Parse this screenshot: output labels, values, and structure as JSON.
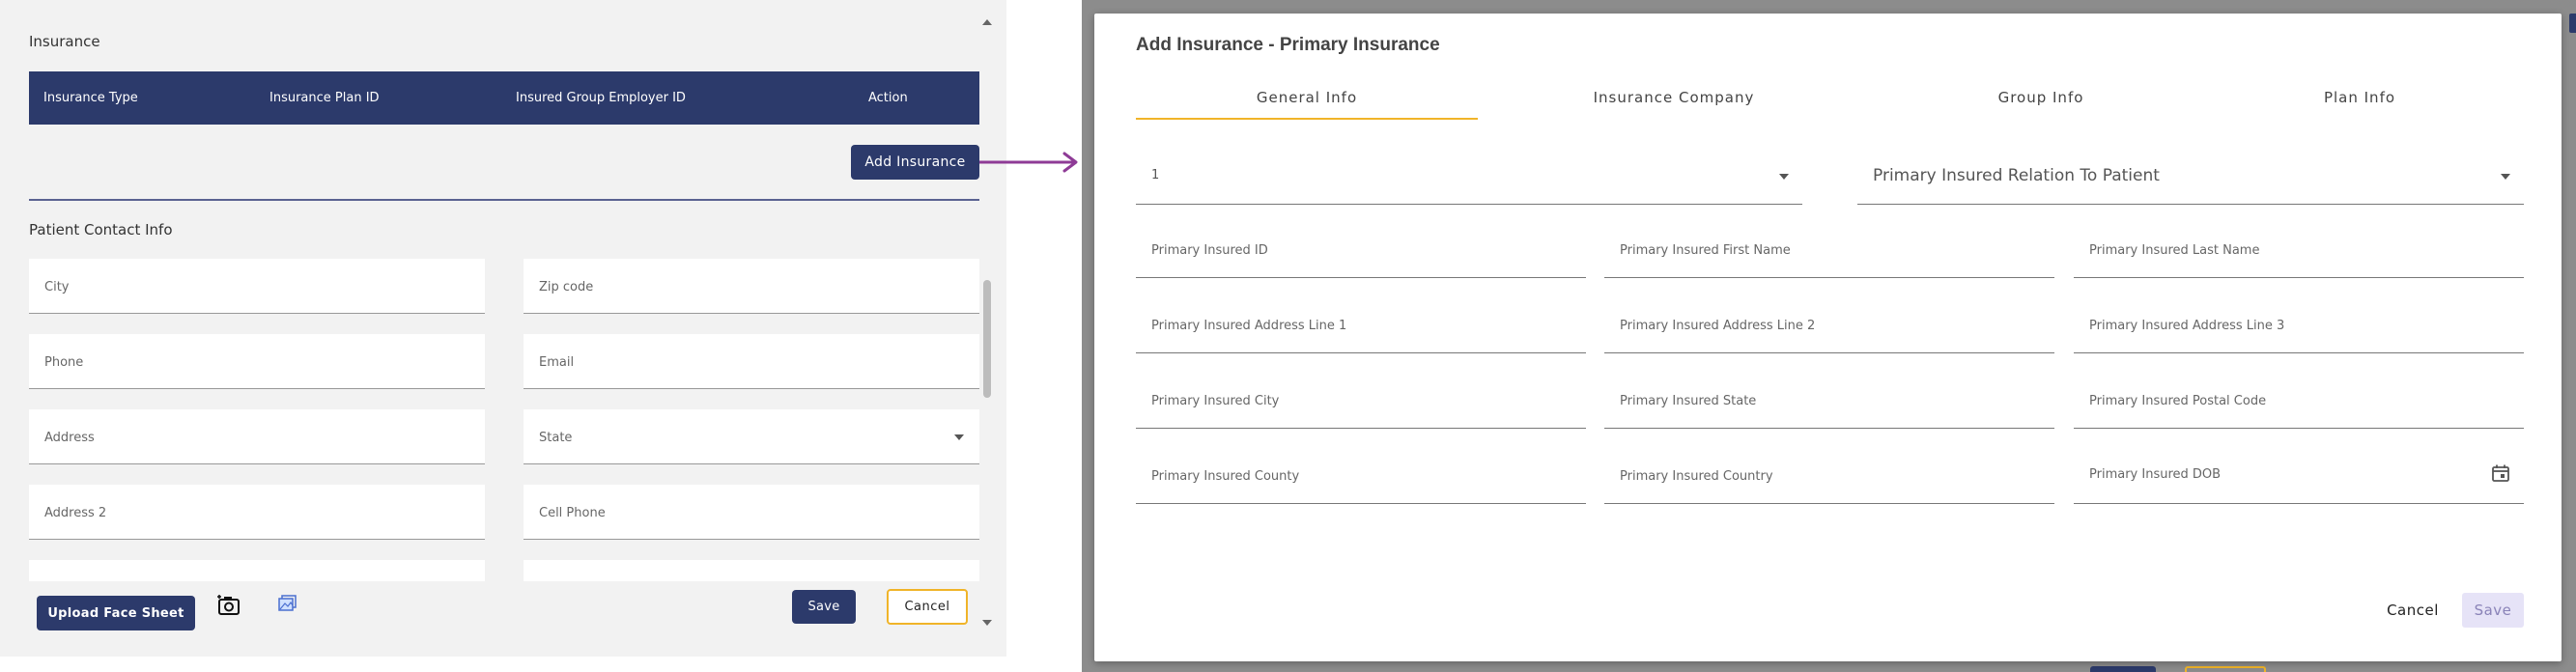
{
  "left": {
    "insurance_heading": "Insurance",
    "table_headers": [
      "Insurance Type",
      "Insurance Plan ID",
      "Insured Group Employer ID",
      "Action"
    ],
    "add_insurance_label": "Add Insurance",
    "contact_heading": "Patient Contact Info",
    "fields": {
      "city": "City",
      "zip": "Zip code",
      "phone": "Phone",
      "email": "Email",
      "address": "Address",
      "state": "State",
      "address2": "Address 2",
      "cell_phone": "Cell Phone"
    },
    "footer": {
      "upload_label": "Upload Face Sheet",
      "save_label": "Save",
      "cancel_label": "Cancel"
    }
  },
  "dialog": {
    "title": "Add Insurance - Primary Insurance",
    "tabs": [
      "General Info",
      "Insurance Company",
      "Group Info",
      "Plan Info"
    ],
    "active_tab": "General Info",
    "select_value": "1",
    "relation_placeholder": "Primary Insured Relation To Patient",
    "fields": {
      "id": "Primary Insured ID",
      "first_name": "Primary Insured First Name",
      "last_name": "Primary Insured Last Name",
      "addr1": "Primary Insured Address Line 1",
      "addr2": "Primary Insured Address Line 2",
      "addr3": "Primary Insured Address Line 3",
      "city": "Primary Insured City",
      "state": "Primary Insured State",
      "postal": "Primary Insured Postal Code",
      "county": "Primary Insured County",
      "country": "Primary Insured Country",
      "dob": "Primary Insured DOB"
    },
    "cancel_label": "Cancel",
    "save_label": "Save"
  },
  "colors": {
    "primary": "#2c3a6b",
    "accent": "#f0b429",
    "arrow": "#8e3b96",
    "save_disabled_bg": "#e6e3f7"
  }
}
